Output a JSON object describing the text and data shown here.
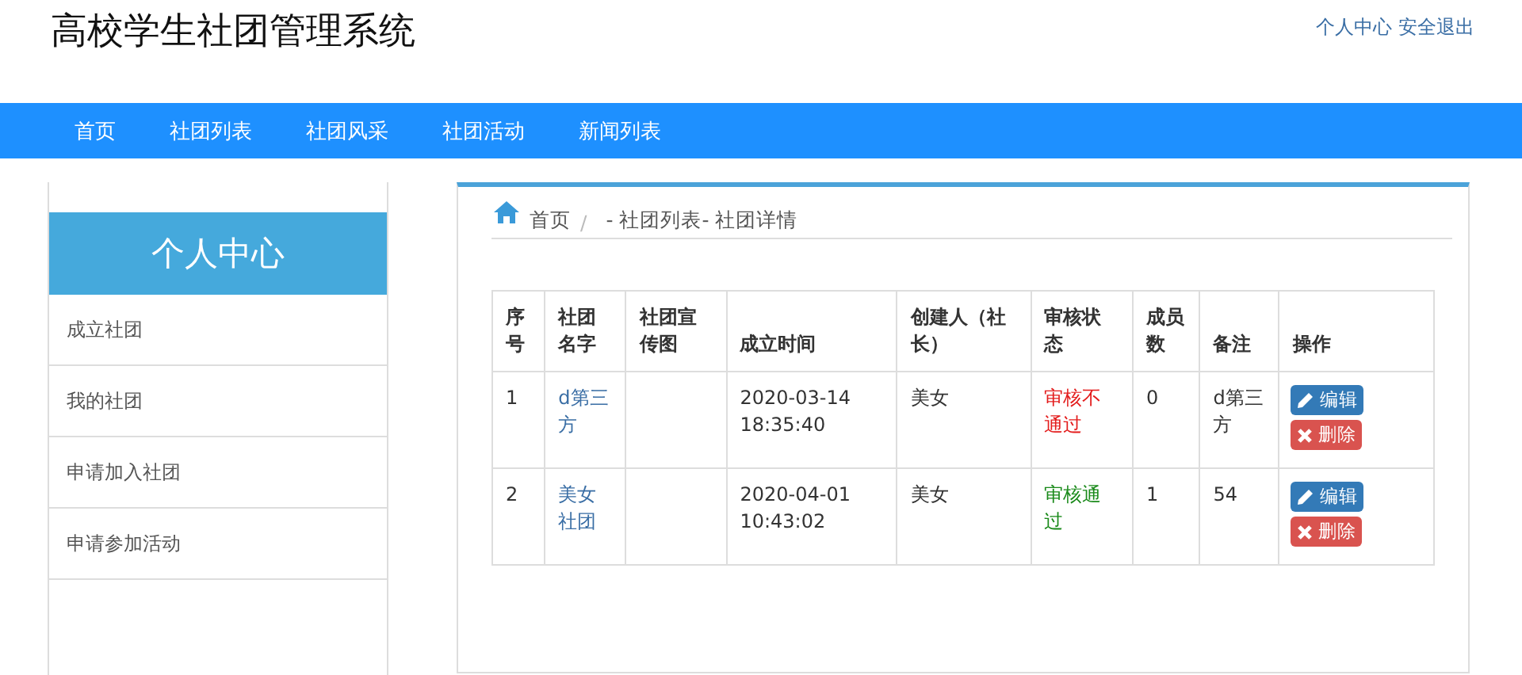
{
  "site_title": "高校学生社团管理系统",
  "user_links": [
    "个人中心",
    "安全退出"
  ],
  "nav": [
    {
      "label": "首页"
    },
    {
      "label": "社团列表"
    },
    {
      "label": "社团风采"
    },
    {
      "label": "社团活动"
    },
    {
      "label": "新闻列表"
    }
  ],
  "sidebar": {
    "title": "个人中心",
    "items": [
      "成立社团",
      "我的社团",
      "申请加入社团",
      "申请参加活动"
    ]
  },
  "breadcrumb": {
    "home": "首页",
    "separator": "/",
    "path": "- 社团列表- 社团详情"
  },
  "table": {
    "columns": [
      "序号",
      "社团名字",
      "社团宣传图",
      "成立时间",
      "创建人（社长）",
      "审核状态",
      "成员数",
      "备注",
      "操作"
    ],
    "rows": [
      {
        "no": "1",
        "name": "d第三方",
        "founded": "2020-03-14 18:35:40",
        "creator": "美女",
        "status": {
          "text": "审核不通过",
          "color": "#e31b1b"
        },
        "members": "0",
        "note": "d第三方",
        "actions": [
          {
            "kind": "edit",
            "label": "编辑"
          },
          {
            "kind": "delete",
            "label": "删除"
          }
        ]
      },
      {
        "no": "2",
        "name": "美女社团",
        "founded": "2020-04-01 10:43:02",
        "creator": "美女",
        "status": {
          "text": "审核通过",
          "color": "#1a8a1a"
        },
        "members": "1",
        "note": "54",
        "actions": [
          {
            "kind": "edit",
            "label": "编辑"
          },
          {
            "kind": "delete",
            "label": "删除"
          }
        ]
      }
    ]
  }
}
